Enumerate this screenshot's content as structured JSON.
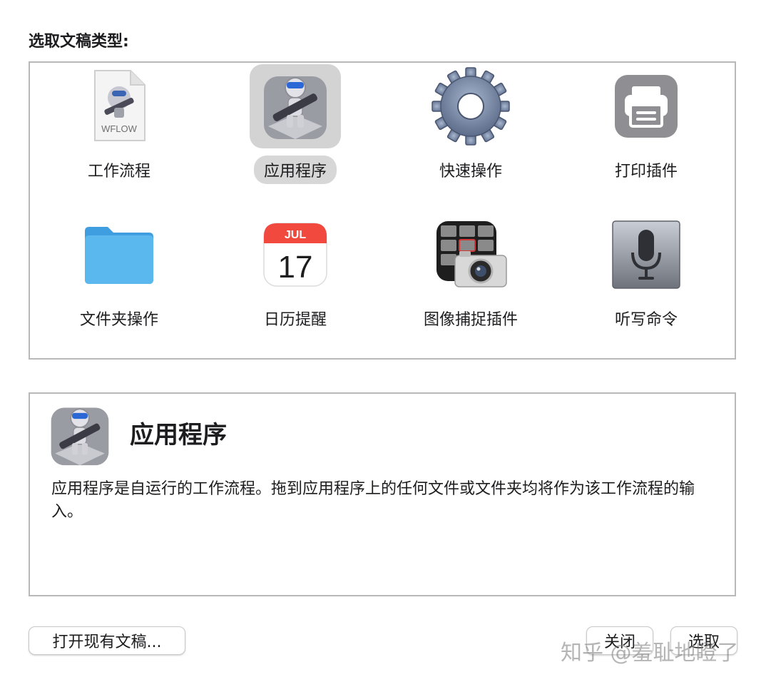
{
  "dialog": {
    "heading": "选取文稿类型:"
  },
  "doc_types": [
    {
      "label": "工作流程",
      "icon": "workflow-file-icon",
      "file_ext": "WFLOW"
    },
    {
      "label": "应用程序",
      "icon": "automator-robot-icon",
      "selected": true
    },
    {
      "label": "快速操作",
      "icon": "gear-icon"
    },
    {
      "label": "打印插件",
      "icon": "printer-icon"
    },
    {
      "label": "文件夹操作",
      "icon": "folder-icon"
    },
    {
      "label": "日历提醒",
      "icon": "calendar-icon",
      "month": "JUL",
      "day": "17"
    },
    {
      "label": "图像捕捉插件",
      "icon": "image-capture-icon"
    },
    {
      "label": "听写命令",
      "icon": "microphone-icon"
    }
  ],
  "description": {
    "title": "应用程序",
    "text": "应用程序是自运行的工作流程。拖到应用程序上的任何文件或文件夹均将作为该工作流程的输入。"
  },
  "buttons": {
    "open_existing": "打开现有文稿...",
    "close": "关闭",
    "choose": "选取"
  },
  "watermark": "知乎 @羞耻地瞪了",
  "colors": {
    "selection_bg": "#d3d3d3",
    "border": "#b9b9b9",
    "folder_blue": "#5ab8ee",
    "calendar_red": "#f2493f"
  }
}
